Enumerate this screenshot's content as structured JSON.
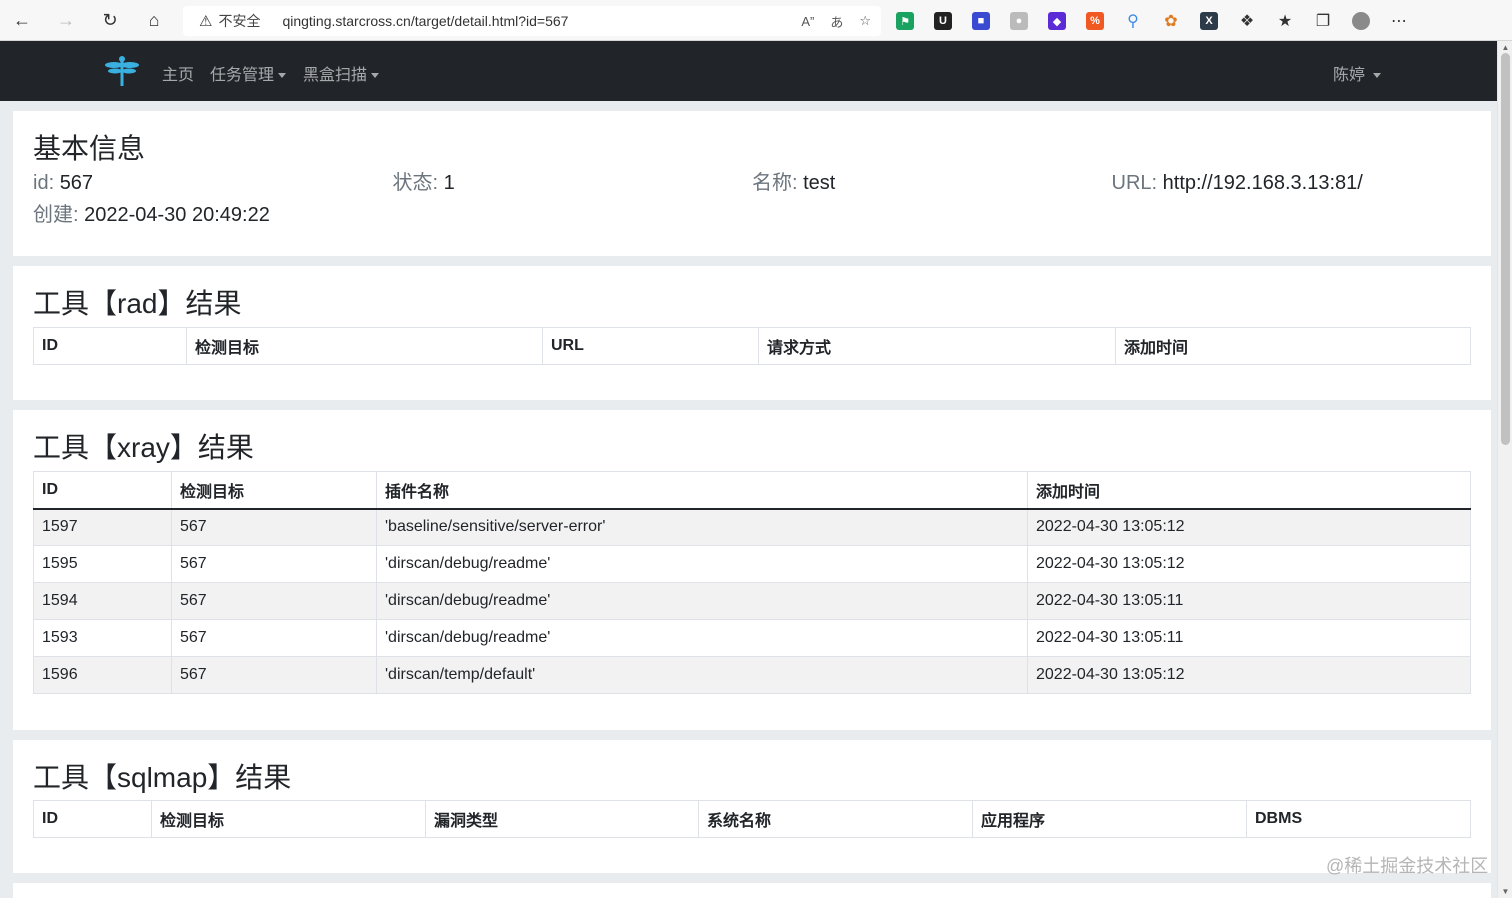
{
  "browser": {
    "insecure_label": "不安全",
    "url": "qingting.starcross.cn/target/detail.html?id=567"
  },
  "navbar": {
    "home": "主页",
    "tasks": "任务管理",
    "blackbox": "黑盒扫描",
    "user": "陈婷"
  },
  "basic_info": {
    "title": "基本信息",
    "id_label": "id:",
    "id_value": "567",
    "status_label": "状态:",
    "status_value": "1",
    "name_label": "名称:",
    "name_value": "test",
    "url_label": "URL:",
    "url_value": "http://192.168.3.13:81/",
    "created_label": "创建:",
    "created_value": "2022-04-30 20:49:22"
  },
  "rad": {
    "title": "工具【rad】结果",
    "headers": [
      "ID",
      "检测目标",
      "URL",
      "请求方式",
      "添加时间"
    ]
  },
  "xray": {
    "title": "工具【xray】结果",
    "headers": [
      "ID",
      "检测目标",
      "插件名称",
      "添加时间"
    ],
    "rows": [
      [
        "1597",
        "567",
        "'baseline/sensitive/server-error'",
        "2022-04-30 13:05:12"
      ],
      [
        "1595",
        "567",
        "'dirscan/debug/readme'",
        "2022-04-30 13:05:12"
      ],
      [
        "1594",
        "567",
        "'dirscan/debug/readme'",
        "2022-04-30 13:05:11"
      ],
      [
        "1593",
        "567",
        "'dirscan/debug/readme'",
        "2022-04-30 13:05:11"
      ],
      [
        "1596",
        "567",
        "'dirscan/temp/default'",
        "2022-04-30 13:05:12"
      ]
    ]
  },
  "sqlmap": {
    "title": "工具【sqlmap】结果",
    "headers": [
      "ID",
      "检测目标",
      "漏洞类型",
      "系统名称",
      "应用程序",
      "DBMS"
    ]
  },
  "watermark": "@稀土掘金技术社区",
  "colors": {
    "navbar_bg": "#212529",
    "page_bg": "#e9ecef",
    "stripe": "#f2f2f2"
  }
}
